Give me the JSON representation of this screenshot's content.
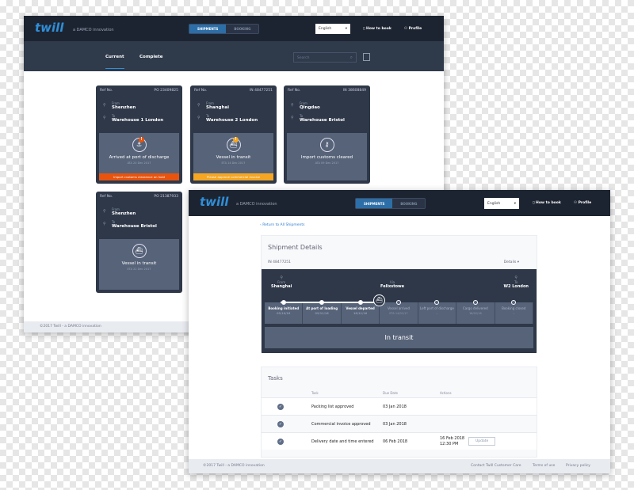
{
  "brand": {
    "logo": "twill",
    "tagline": "a DAMCO innovation"
  },
  "nav": {
    "shipments": "SHIPMENTS",
    "booking": "BOOKING",
    "language": "English",
    "how_to_book": "How to book",
    "profile": "Profile"
  },
  "list_view": {
    "tabs": [
      "Current",
      "Complete"
    ],
    "search_placeholder": "Search",
    "footer": "©2017 Twill - a DAMCO innovation",
    "ref_label": "Ref No.",
    "from_label": "From",
    "to_label": "To",
    "cards": [
      {
        "ref": "PO 23409825",
        "from": "Shenzhen",
        "to": "Warehouse 1 London",
        "status": "Arrived at port of discharge",
        "date": "ATA 20 Dec 2017",
        "alert": "Import customs clearance on hold",
        "alert_color": "#e8540e"
      },
      {
        "ref": "IN 48477251",
        "from": "Shanghai",
        "to": "Warehouse 2 London",
        "status": "Vessel in transit",
        "date": "ETA 14 Dec 2017",
        "alert": "Please approve commercial invoice",
        "alert_color": "#f5a623"
      },
      {
        "ref": "IN 38608849",
        "from": "Qingdao",
        "to": "Warehouse Bristol",
        "status": "Import customs cleared",
        "date": "ATA 09 Dec 2017"
      },
      {
        "ref": "PO 21387933",
        "from": "Shenzhen",
        "to": "Warehouse Bristol",
        "status": "Vessel in transit",
        "date": "ETA 22 Dec 2017"
      }
    ]
  },
  "detail_view": {
    "back_link": "Return to All Shipments",
    "title": "Shipment Details",
    "ref": "IN 48477251",
    "details_toggle": "Details",
    "from_label": "From",
    "from": "Shanghai",
    "via_label": "Via",
    "via": "Felixstowe",
    "to_label": "To",
    "to": "W2 London",
    "steps": [
      {
        "label": "Booking initiated",
        "date": "03/10/16",
        "done": true
      },
      {
        "label": "At port of loading",
        "date": "09/11/16",
        "done": true
      },
      {
        "label": "Vessel departed",
        "date": "16/11/16",
        "done": true
      },
      {
        "label": "Vessel arrived",
        "date": "ETA 14/01/17",
        "done": false
      },
      {
        "label": "Left port of discharge",
        "date": "--",
        "done": false
      },
      {
        "label": "Cargo delivered",
        "date": "16/02/18",
        "done": false
      },
      {
        "label": "Booking closed",
        "date": "--",
        "done": false
      }
    ],
    "status": "In transit",
    "tasks": {
      "title": "Tasks",
      "headers": [
        "Task",
        "Due Date",
        "Actions"
      ],
      "rows": [
        {
          "task": "Packing list approved",
          "due": "03 Jan 2018"
        },
        {
          "task": "Commercial invoice approved",
          "due": "03 Jan 2018"
        },
        {
          "task": "Delivery date and time entered",
          "due": "06 Feb 2018",
          "action_date": "16 Feb 2018",
          "action_time": "12:30 PM",
          "button": "Update"
        }
      ]
    },
    "footer": {
      "copyright": "©2017 Twill - a DAMCO innovation",
      "links": [
        "Contact Twill Customer Care",
        "Terms of use",
        "Privacy policy"
      ]
    }
  },
  "colors": {
    "header": "#1d2431",
    "accent": "#2c6ea8",
    "card": "#2e3849"
  }
}
